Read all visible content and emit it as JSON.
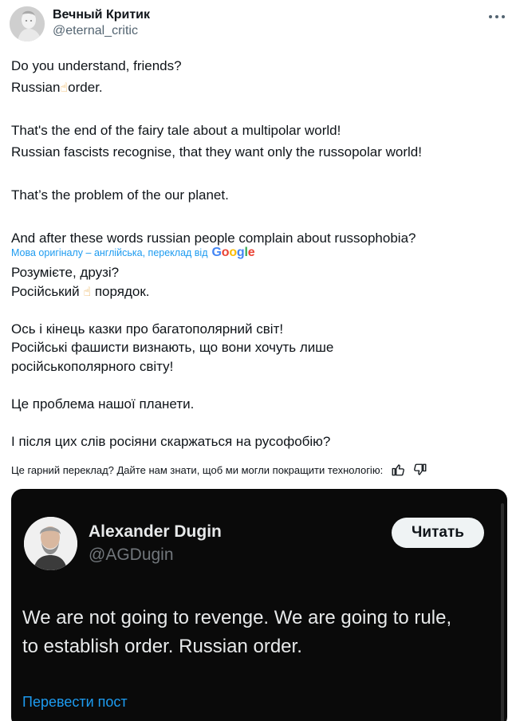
{
  "author": {
    "display_name": "Вечный Критик",
    "handle": "@eternal_critic"
  },
  "original_text": [
    "Do you understand, friends?",
    [
      "Russian",
      "☝",
      "order."
    ],
    "",
    "That's the end of the fairy tale about a multipolar world!",
    "Russian fascists recognise, that they want only the russopolar world!",
    "",
    "That’s the problem of the our planet.",
    "",
    "And after these words russian people complain about russophobia?"
  ],
  "translation_attribution": {
    "text": "Мова оригіналу – англійська, переклад від",
    "provider_letters": [
      "G",
      "o",
      "o",
      "g",
      "l",
      "e"
    ]
  },
  "translated_text": [
    "Розумієте, друзі?",
    [
      "Російський",
      "☝",
      "порядок."
    ],
    "",
    "Ось і кінець казки про багатополярний світ!",
    "Російські фашисти визнають, що вони хочуть лише",
    "російськополярного світу!",
    "",
    "Це проблема нашої планети.",
    "",
    "І після цих слів росіяни скаржаться на русофобію?"
  ],
  "feedback": {
    "text": "Це гарний переклад? Дайте нам знати, щоб ми могли покращити технологію:",
    "like_icon": "thumbs-up-icon",
    "dislike_icon": "thumbs-down-icon"
  },
  "quoted_post": {
    "display_name": "Alexander Dugin",
    "handle": "@AGDugin",
    "follow_label": "Читать",
    "text_lines": [
      "We are not going to revenge. We are going to rule,",
      "to establish order. Russian order."
    ],
    "translate_label": "Перевести пост"
  },
  "colors": {
    "link_blue": "#1d9bf0",
    "card_bg": "#0a0a0a",
    "secondary_text": "#536471"
  }
}
